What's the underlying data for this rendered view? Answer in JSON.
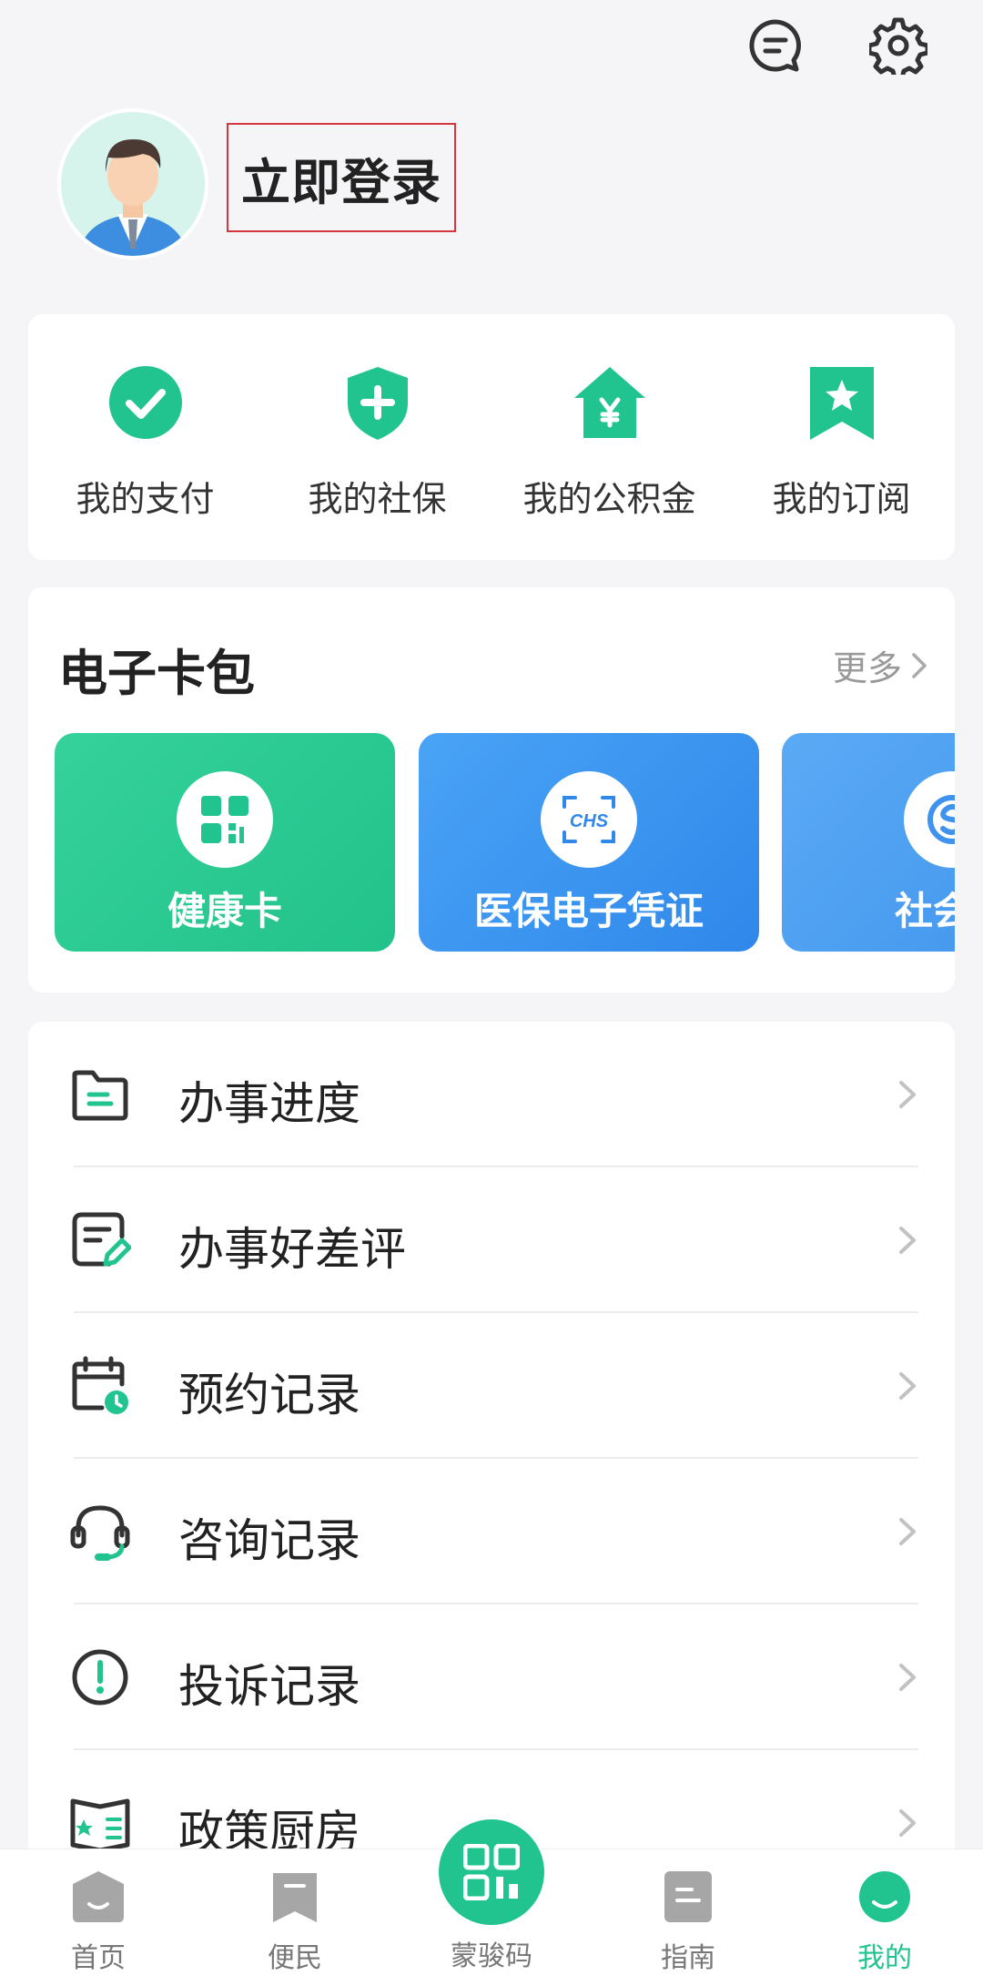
{
  "header": {
    "message_icon": "message-icon",
    "settings_icon": "settings-icon"
  },
  "profile": {
    "login_text": "立即登录"
  },
  "quick_actions": [
    {
      "label": "我的支付",
      "icon": "check-circle-icon"
    },
    {
      "label": "我的社保",
      "icon": "shield-plus-icon"
    },
    {
      "label": "我的公积金",
      "icon": "house-yen-icon"
    },
    {
      "label": "我的订阅",
      "icon": "bookmark-star-icon"
    }
  ],
  "wallet": {
    "title": "电子卡包",
    "more": "更多",
    "cards": [
      {
        "label": "健康卡",
        "color": "#2ecb93"
      },
      {
        "label": "医保电子凭证",
        "color": "#3d97f0"
      },
      {
        "label": "社会保",
        "color": "#4b9bf1"
      }
    ],
    "chs_text": "CHS"
  },
  "menu": [
    {
      "label": "办事进度",
      "icon": "document-icon"
    },
    {
      "label": "办事好差评",
      "icon": "review-edit-icon"
    },
    {
      "label": "预约记录",
      "icon": "calendar-clock-icon"
    },
    {
      "label": "咨询记录",
      "icon": "headset-icon"
    },
    {
      "label": "投诉记录",
      "icon": "alert-circle-icon"
    },
    {
      "label": "政策厨房",
      "icon": "book-icon"
    }
  ],
  "bottom_nav": [
    {
      "label": "首页"
    },
    {
      "label": "便民"
    },
    {
      "label": "蒙骏码"
    },
    {
      "label": "指南"
    },
    {
      "label": "我的"
    }
  ],
  "colors": {
    "accent": "#21c48f",
    "text": "#222222",
    "muted": "#999999",
    "alert": "#d4363b"
  }
}
